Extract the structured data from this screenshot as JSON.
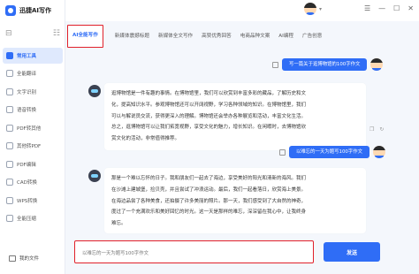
{
  "app": {
    "name": "迅捷AI写作"
  },
  "sidebar": {
    "items": [
      {
        "label": "常用工具",
        "active": true
      },
      {
        "label": "全能翻译"
      },
      {
        "label": "文字识别"
      },
      {
        "label": "语音转换"
      },
      {
        "label": "PDF转其他"
      },
      {
        "label": "其他转PDF"
      },
      {
        "label": "PDF编辑"
      },
      {
        "label": "CAD转换"
      },
      {
        "label": "WPS转换"
      },
      {
        "label": "全能压缩"
      },
      {
        "label": "我的文件"
      }
    ]
  },
  "tabs": [
    {
      "label": "AI全能写作",
      "active": true
    },
    {
      "label": "新媒体震撼标题"
    },
    {
      "label": "新媒体全文写作"
    },
    {
      "label": "高赞优秀回答"
    },
    {
      "label": "电商品种文案"
    },
    {
      "label": "AI编程"
    },
    {
      "label": "广告创意"
    }
  ],
  "chat": {
    "q1": "写一篇关于逛博物馆的100字作文",
    "a1": [
      "逛博物馆是一件有趣的事情。在博物馆里，我们可以欣赏到丰富多彩的藏品，了解历史和文",
      "化，提高知识水平。参观博物馆还可以开阔视野，学习各种领域的知识。在博物馆里，我们",
      "可以与解说员交流，获得更深入的理解。博物馆还会举办各种展览和活动，丰富文化生活。",
      "总之，逛博物馆可以让我们拓宽视野，享受文化的魅力，增长知识。在闲暇时，去博物馆欣",
      "赏文化的活动，非常值得推荐。"
    ],
    "q2": "以难忘的一天为题写100字作文",
    "a2": [
      "那是一个难以忘怀的日子。我和朋友们一起去了海边，享受美好的阳光和清新的海风。我们",
      "在沙滩上建城堡，捡贝壳，并且尝试了冲浪运动。最后，我们一起看落日，欣赏海上美景。",
      "在海边品尝了各种美食，还拍摄了许多美丽的照片。那一天，我们感受到了大自然的神奇，",
      "度过了一个充满欢乐和美好回忆的时光。这一天是那样的难忘，深深留在我心中，让我终身",
      "难忘。"
    ]
  },
  "input": {
    "placeholder": "以难忘的一天为题写100字作文"
  },
  "send": {
    "label": "发送"
  },
  "colors": {
    "accent": "#2f6df6",
    "highlight_border": "#e0202a"
  }
}
